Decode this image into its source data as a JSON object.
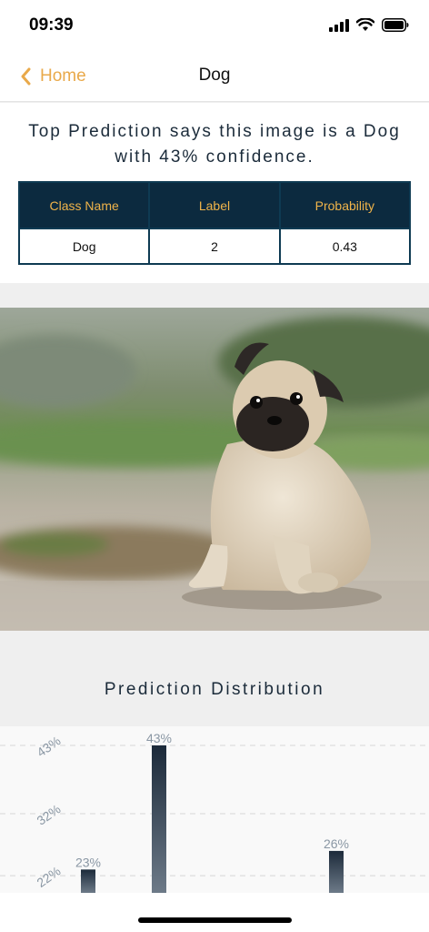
{
  "status_bar": {
    "time": "09:39"
  },
  "nav": {
    "back_label": "Home",
    "title": "Dog"
  },
  "prediction": {
    "text": "Top Prediction says this image is a Dog with 43% confidence."
  },
  "table": {
    "headers": [
      "Class Name",
      "Label",
      "Probability"
    ],
    "rows": [
      [
        "Dog",
        "2",
        "0.43"
      ]
    ]
  },
  "image": {
    "subject": "pug sitting on gravel path"
  },
  "distribution": {
    "title": "Prediction Distribution"
  },
  "chart_data": {
    "type": "bar",
    "title": "Prediction Distribution",
    "xlabel": "",
    "ylabel": "",
    "y_ticks": [
      "43%",
      "32%",
      "22%"
    ],
    "grid": true,
    "series": [
      {
        "values": [
          23,
          43,
          26
        ]
      }
    ],
    "value_labels": [
      "23%",
      "43%",
      "26%"
    ],
    "colors": {
      "bar_top": "#1c2a3a",
      "bar_bottom": "#6d7a88",
      "label": "#8a97a4"
    }
  },
  "colors": {
    "accent": "#e9a94a",
    "table_header": "#0c2a3f",
    "table_border": "#0e3a52"
  }
}
